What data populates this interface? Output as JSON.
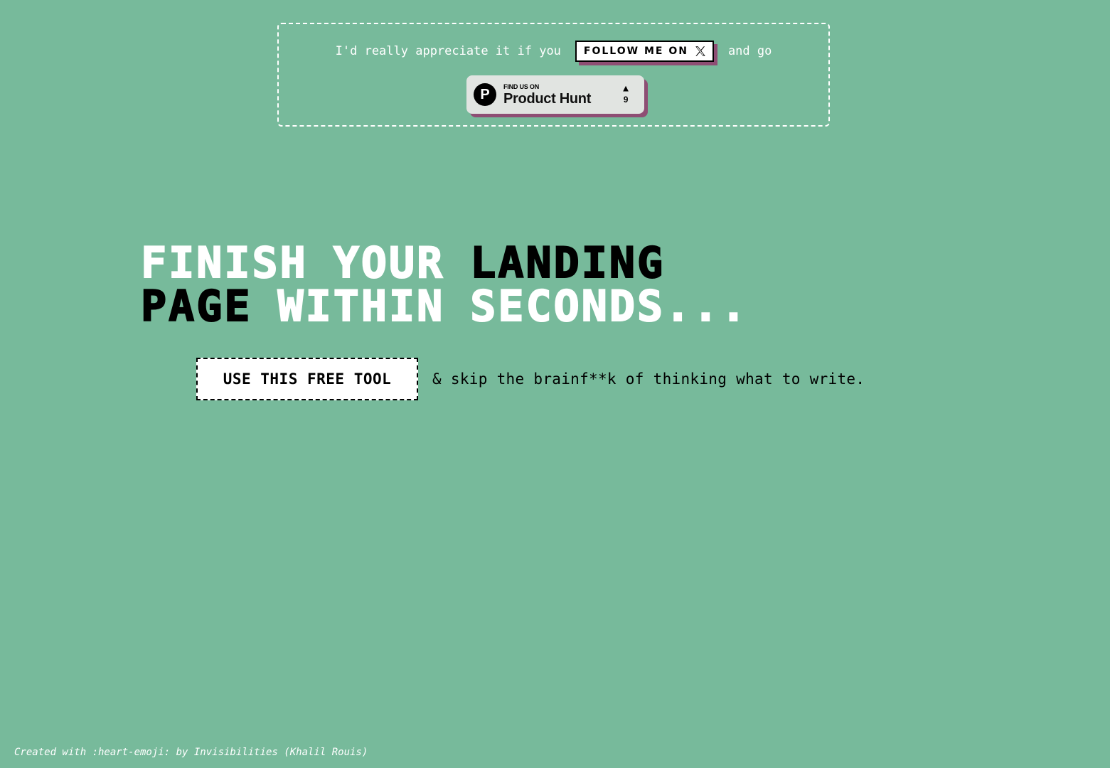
{
  "promo": {
    "text_before": "I'd really appreciate it if you",
    "follow_label": "FOLLOW ME ON",
    "follow_icon": "x-logo-icon",
    "text_after": "and go",
    "product_hunt": {
      "small_label": "FIND US ON",
      "big_label": "Product Hunt",
      "logo_letter": "P",
      "vote_arrow": "▲",
      "vote_count": "9"
    }
  },
  "hero": {
    "line1": [
      {
        "text": "FINISH",
        "color": "white"
      },
      {
        "text": "YOUR",
        "color": "white"
      },
      {
        "text": "LANDING",
        "color": "black"
      }
    ],
    "line2": [
      {
        "text": "PAGE",
        "color": "black"
      },
      {
        "text": "WITHIN",
        "color": "white"
      },
      {
        "text": "SECONDS...",
        "color": "white"
      }
    ]
  },
  "cta": {
    "button_label": "USE THIS FREE TOOL",
    "trailing_text": "& skip the brainf**k of thinking what to write."
  },
  "footer": {
    "text": "Created with :heart-emoji: by Invisibilities (Khalil Rouis)"
  },
  "colors": {
    "background": "#77ba9b",
    "accent_shadow": "#8e4e74",
    "text_light": "#ffffff",
    "text_dark": "#000000"
  }
}
